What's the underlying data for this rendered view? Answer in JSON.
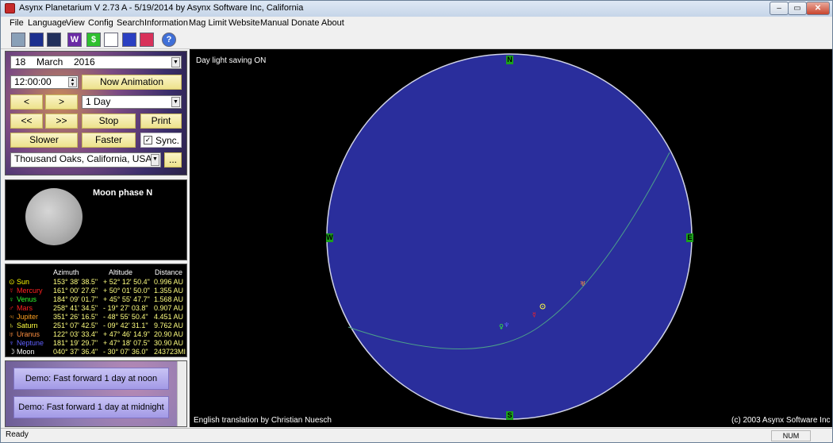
{
  "window": {
    "title": "Asynx Planetarium V 2.73 A - 5/19/2014 by Asynx Software Inc, California",
    "min_label": "–",
    "max_label": "▭",
    "close_label": "✕"
  },
  "menu": [
    "File",
    "Language",
    "View",
    "Config",
    "Search",
    "Information",
    "Mag Limit",
    "Website",
    "Manual",
    "Donate",
    "About"
  ],
  "toolbar": {
    "icons": [
      "photo-icon",
      "constellation-icon",
      "galaxy-icon",
      "w-icon",
      "dollar-icon",
      "copy-icon",
      "earth-icon",
      "chart-icon",
      "help-icon"
    ],
    "labels": [
      "",
      "",
      "",
      "W",
      "$",
      "",
      "",
      "",
      "?"
    ],
    "colors": [
      "#8aa0b8",
      "#1c2f8f",
      "#22305c",
      "#6b2ba6",
      "#2fc02f",
      "#ffffff",
      "#2a3fc2",
      "#d8315a",
      "#3f6fd8"
    ]
  },
  "controls": {
    "date_day": "18",
    "date_month": "March",
    "date_year": "2016",
    "time": "12:00:00",
    "now_animation": "Now Animation",
    "prev": "<",
    "next": ">",
    "step": "1 Day",
    "fast_prev": "<<",
    "fast_next": ">>",
    "stop": "Stop",
    "print": "Print",
    "slower": "Slower",
    "faster": "Faster",
    "sync": "Sync.",
    "sync_checked": true,
    "location": "Thousand Oaks, California, USA",
    "more": "..."
  },
  "moon": {
    "phase_label": "Moon phase  N"
  },
  "planets": {
    "headers": [
      "Azimuth",
      "Altitude",
      "Distance"
    ],
    "rows": [
      {
        "symbol": "⊙",
        "name": "Sun",
        "az": "153° 38' 38.5\"",
        "alt": "+ 52° 12' 50.4\"",
        "dist": "0.996 AU",
        "color": "#ffff00"
      },
      {
        "symbol": "☿",
        "name": "Mercury",
        "az": "161° 00' 27.6\"",
        "alt": "+ 50° 01' 50.0\"",
        "dist": "1.355 AU",
        "color": "#ff2020"
      },
      {
        "symbol": "♀",
        "name": "Venus",
        "az": "184° 09' 01.7\"",
        "alt": "+ 45° 55' 47.7\"",
        "dist": "1.568 AU",
        "color": "#30ff30"
      },
      {
        "symbol": "♂",
        "name": "Mars",
        "az": "258° 41' 34.5\"",
        "alt": "-  19° 27' 03.8\"",
        "dist": "0.907 AU",
        "color": "#ff2020"
      },
      {
        "symbol": "♃",
        "name": "Jupiter",
        "az": "351° 26' 16.5\"",
        "alt": "-  48° 55' 50.4\"",
        "dist": "4.451 AU",
        "color": "#ffa020"
      },
      {
        "symbol": "♄",
        "name": "Saturn",
        "az": "251° 07' 42.5\"",
        "alt": "-  09° 42' 31.1\"",
        "dist": "9.762 AU",
        "color": "#ffff40"
      },
      {
        "symbol": "♅",
        "name": "Uranus",
        "az": "122° 03' 33.4\"",
        "alt": "+ 47° 46' 14.9\"",
        "dist": "20.90 AU",
        "color": "#ff9040"
      },
      {
        "symbol": "♆",
        "name": "Neptune",
        "az": "181° 19' 29.7\"",
        "alt": "+ 47° 18' 07.5\"",
        "dist": "30.90 AU",
        "color": "#6060ff"
      },
      {
        "symbol": "☽",
        "name": "Moon",
        "az": "040° 37' 36.4\"",
        "alt": "-  30° 07' 36.0\"",
        "dist": "243723MI",
        "color": "#ffffff"
      }
    ]
  },
  "demos": [
    "Demo: Fast forward 1 day at noon",
    "Demo: Fast forward 1 day at midnight"
  ],
  "sky": {
    "daylight": "Day light saving ON",
    "translation": "English translation by Christian Nuesch",
    "copyright": "(c) 2003 Asynx Software Inc",
    "compass": {
      "north": "N",
      "south": "S",
      "east": "E",
      "west": "W"
    },
    "dome_color": "#2a2e9c",
    "ecliptic_color": "#4ca08a"
  },
  "status": {
    "text": "Ready",
    "num": "NUM"
  }
}
